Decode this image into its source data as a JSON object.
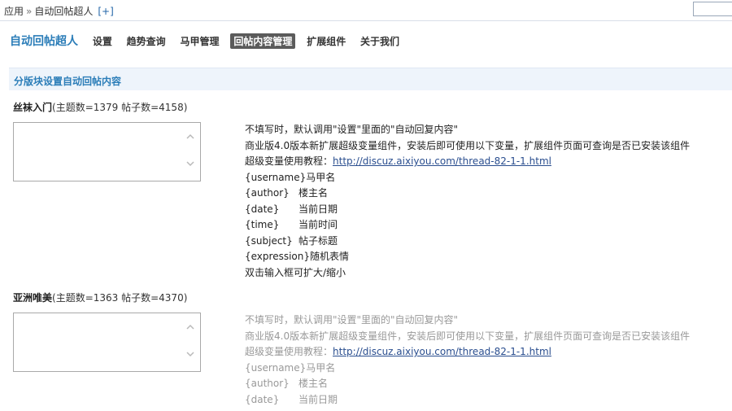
{
  "breadcrumb": {
    "root": "应用",
    "separator": "»",
    "current": "自动回帖超人",
    "add": "[+]"
  },
  "nav": {
    "app_title": "自动回帖超人",
    "items": [
      "设置",
      "趋势查询",
      "马甲管理",
      "回帖内容管理",
      "扩展组件",
      "关于我们"
    ],
    "active_index": 3
  },
  "section": {
    "title": "分版块设置自动回帖内容"
  },
  "forums": [
    {
      "name": "丝袜入门",
      "stats": "(主题数=1379 帖子数=4158)",
      "help": {
        "line1": "不填写时，默认调用\"设置\"里面的\"自动回复内容\"",
        "line2": "商业版4.0版本新扩展超级变量组件，安装后即可使用以下变量，扩展组件页面可查询是否已安装该组件",
        "tutorial_label": "超级变量使用教程：",
        "tutorial_link": "http://discuz.aixiyou.com/thread-82-1-1.html",
        "vars": [
          {
            "tag": "{username}",
            "desc": "马甲名"
          },
          {
            "tag": "{author}",
            "desc": "楼主名"
          },
          {
            "tag": "{date}",
            "desc": "当前日期"
          },
          {
            "tag": "{time}",
            "desc": "当前时间"
          },
          {
            "tag": "{subject}",
            "desc": "帖子标题"
          },
          {
            "tag": "{expression}",
            "desc": "随机表情"
          }
        ],
        "footer": "双击输入框可扩大/缩小"
      }
    },
    {
      "name": "亚洲唯美",
      "stats": "(主题数=1363 帖子数=4370)",
      "help": {
        "line1": "不填写时，默认调用\"设置\"里面的\"自动回复内容\"",
        "line2": "商业版4.0版本新扩展超级变量组件，安装后即可使用以下变量，扩展组件页面可查询是否已安装该组件",
        "tutorial_label": "超级变量使用教程：",
        "tutorial_link": "http://discuz.aixiyou.com/thread-82-1-1.html",
        "vars": [
          {
            "tag": "{username}",
            "desc": "马甲名"
          },
          {
            "tag": "{author}",
            "desc": "楼主名"
          },
          {
            "tag": "{date}",
            "desc": "当前日期"
          }
        ]
      }
    }
  ],
  "icons": {
    "scroll_up": "chevron-up-icon",
    "scroll_down": "chevron-down-icon"
  },
  "colors": {
    "accent": "#2b7db8",
    "active_tab_bg": "#5b5b5b",
    "section_bg": "#eef4fb",
    "link": "#2a4e8f"
  }
}
